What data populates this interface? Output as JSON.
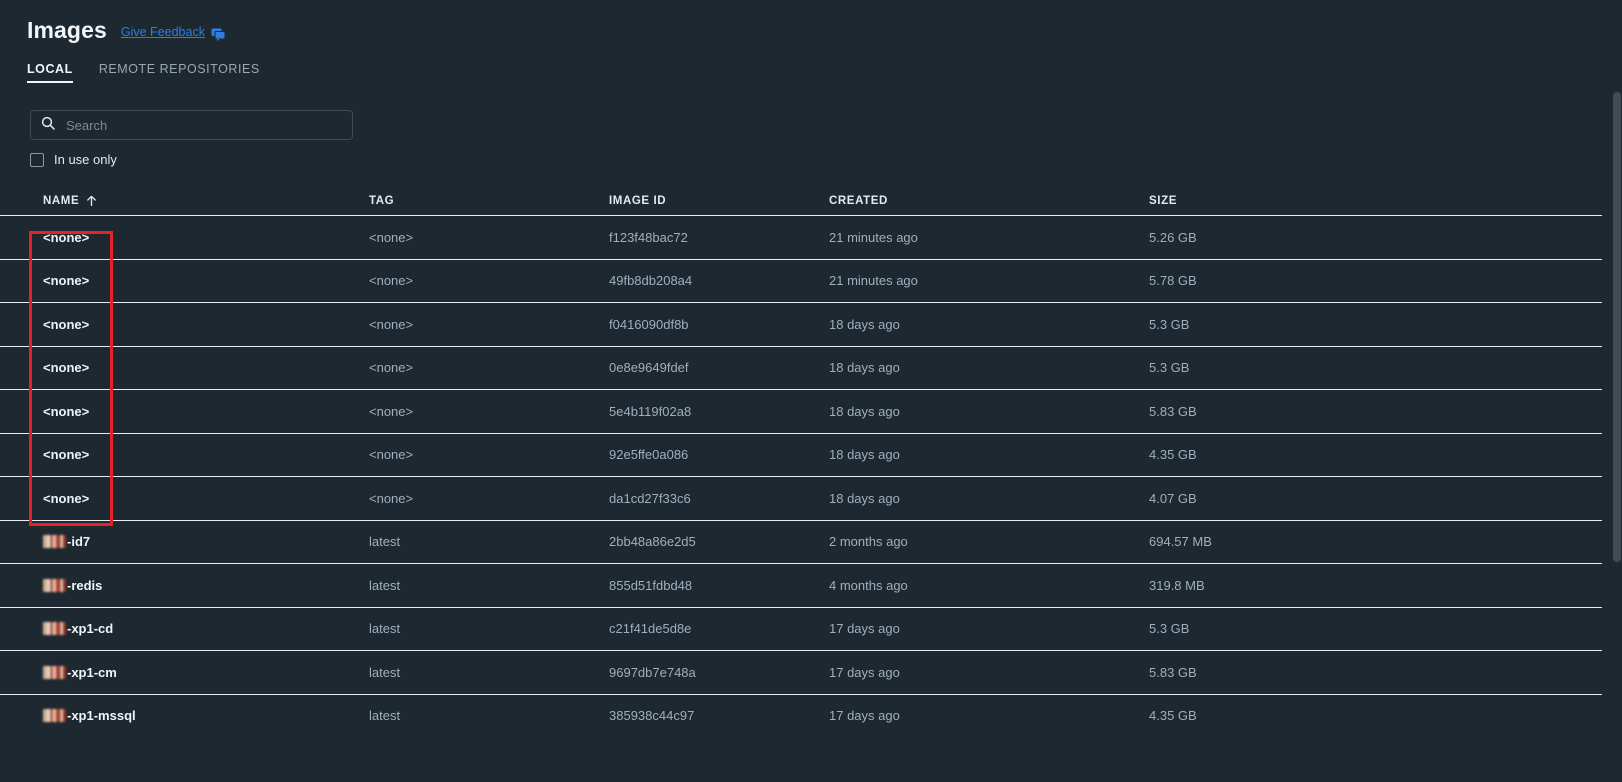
{
  "header": {
    "title": "Images",
    "feedback_label": "Give Feedback",
    "feedback_icon": "feedback-chat-icon"
  },
  "tabs": [
    {
      "label": "LOCAL",
      "active": true
    },
    {
      "label": "REMOTE REPOSITORIES",
      "active": false
    }
  ],
  "search": {
    "placeholder": "Search",
    "value": "",
    "icon": "search-icon"
  },
  "filter": {
    "in_use_only_label": "In use only",
    "in_use_only_checked": false
  },
  "table": {
    "columns": [
      {
        "key": "name",
        "label": "NAME",
        "sorted": true,
        "sort_dir": "asc",
        "sort_icon": "arrow-up-icon"
      },
      {
        "key": "tag",
        "label": "TAG"
      },
      {
        "key": "image_id",
        "label": "IMAGE ID"
      },
      {
        "key": "created",
        "label": "CREATED"
      },
      {
        "key": "size",
        "label": "SIZE"
      }
    ],
    "rows": [
      {
        "name": "<none>",
        "redacted": false,
        "tag": "<none>",
        "image_id": "f123f48bac72",
        "created": "21 minutes ago",
        "size": "5.26 GB"
      },
      {
        "name": "<none>",
        "redacted": false,
        "tag": "<none>",
        "image_id": "49fb8db208a4",
        "created": "21 minutes ago",
        "size": "5.78 GB"
      },
      {
        "name": "<none>",
        "redacted": false,
        "tag": "<none>",
        "image_id": "f0416090df8b",
        "created": "18 days ago",
        "size": "5.3 GB"
      },
      {
        "name": "<none>",
        "redacted": false,
        "tag": "<none>",
        "image_id": "0e8e9649fdef",
        "created": "18 days ago",
        "size": "5.3 GB"
      },
      {
        "name": "<none>",
        "redacted": false,
        "tag": "<none>",
        "image_id": "5e4b119f02a8",
        "created": "18 days ago",
        "size": "5.83 GB"
      },
      {
        "name": "<none>",
        "redacted": false,
        "tag": "<none>",
        "image_id": "92e5ffe0a086",
        "created": "18 days ago",
        "size": "4.35 GB"
      },
      {
        "name": "<none>",
        "redacted": false,
        "tag": "<none>",
        "image_id": "da1cd27f33c6",
        "created": "18 days ago",
        "size": "4.07 GB"
      },
      {
        "name": "-id7",
        "redacted": true,
        "tag": "latest",
        "image_id": "2bb48a86e2d5",
        "created": "2 months ago",
        "size": "694.57 MB"
      },
      {
        "name": "-redis",
        "redacted": true,
        "tag": "latest",
        "image_id": "855d51fdbd48",
        "created": "4 months ago",
        "size": "319.8 MB"
      },
      {
        "name": "-xp1-cd",
        "redacted": true,
        "tag": "latest",
        "image_id": "c21f41de5d8e",
        "created": "17 days ago",
        "size": "5.3 GB"
      },
      {
        "name": "-xp1-cm",
        "redacted": true,
        "tag": "latest",
        "image_id": "9697db7e748a",
        "created": "17 days ago",
        "size": "5.83 GB"
      },
      {
        "name": "-xp1-mssql",
        "redacted": true,
        "tag": "latest",
        "image_id": "385938c44c97",
        "created": "17 days ago",
        "size": "4.35 GB"
      }
    ]
  },
  "annotation": {
    "shape": "rectangle",
    "color": "#e8202a",
    "target": "name-column-none-rows"
  },
  "colors": {
    "background": "#1d2830",
    "row_divider": "#e9eef1",
    "link": "#2f7de1",
    "muted_text": "#9fb0bc",
    "primary_text": "#f2f6f8",
    "annotation_red": "#e8202a"
  },
  "scrollbar": {
    "visible": true
  }
}
